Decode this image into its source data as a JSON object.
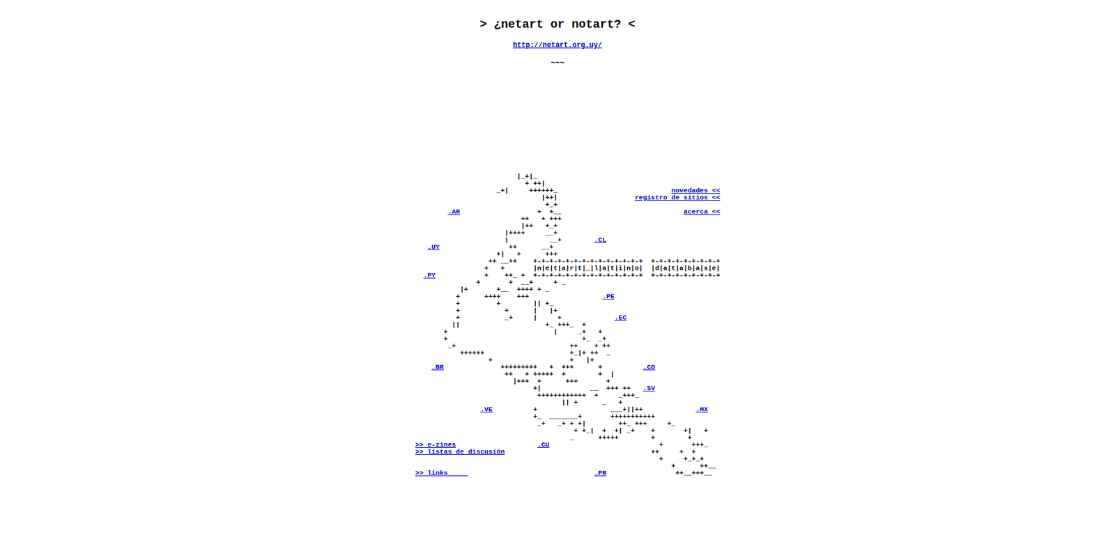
{
  "page": {
    "title": "> ¿netart or notart? <",
    "url": "http://netart.org.uy/",
    "divider": "~~~"
  },
  "art": [
    [
      {
        "text": "                         |_+|_",
        "link": false
      }
    ],
    [
      {
        "text": "                           + ++|",
        "link": false
      }
    ],
    [
      {
        "text": "                    _+|     ++++++_                            ",
        "link": false
      },
      {
        "text": "novedades <<",
        "link": true
      }
    ],
    [
      {
        "text": "                               |++|                   ",
        "link": false
      },
      {
        "text": "registro de sitios <<",
        "link": true
      }
    ],
    [
      {
        "text": "                                +_+",
        "link": false
      }
    ],
    [
      {
        "text": "        ",
        "link": false
      },
      {
        "text": ".AR",
        "link": true
      },
      {
        "text": "                   +  +__                              ",
        "link": false
      },
      {
        "text": "acerca <<",
        "link": true
      }
    ],
    [
      {
        "text": "                          ++   + +++",
        "link": false
      }
    ],
    [
      {
        "text": "                          |++   +_+",
        "link": false
      }
    ],
    [
      {
        "text": "                      |++++     __+",
        "link": false
      }
    ],
    [
      {
        "text": "                      |          __+        ",
        "link": false
      },
      {
        "text": ".CL",
        "link": true
      }
    ],
    [
      {
        "text": "   ",
        "link": false
      },
      {
        "text": ".UY",
        "link": true
      },
      {
        "text": "                 ++      __+",
        "link": false
      }
    ],
    [
      {
        "text": "                    +|   +      +++",
        "link": false
      }
    ],
    [
      {
        "text": "                  ++ __++    +-+-+-+-+-+-+-+-+-+-+-+-+-+  +-+-+-+-+-+-+-+-+",
        "link": false
      }
    ],
    [
      {
        "text": "                 +   +       |n|e|t|a|r|t|_|l|a|t|i|n|o|  |d|a|t|a|b|a|s|e|",
        "link": false
      }
    ],
    [
      {
        "text": "  ",
        "link": false
      },
      {
        "text": ".PY",
        "link": true
      },
      {
        "text": "            +    ++_ +  +-+-+-+-+-+-+-+-+-+-+-+-+-+  +-+-+-+-+-+-+-+-+",
        "link": false
      }
    ],
    [
      {
        "text": "               +       +  __+     + _",
        "link": false
      }
    ],
    [
      {
        "text": "           |+       +__  ++++ + _",
        "link": false
      }
    ],
    [
      {
        "text": "          +      ++++    +++                  ",
        "link": false
      },
      {
        "text": ".PE",
        "link": true
      }
    ],
    [
      {
        "text": "          +         +        || +_",
        "link": false
      }
    ],
    [
      {
        "text": "          +           +      |   |+",
        "link": false
      }
    ],
    [
      {
        "text": "          +           _+     |     +             ",
        "link": false
      },
      {
        "text": ".EC",
        "link": true
      }
    ],
    [
      {
        "text": "         ||                     +_ +++_  +",
        "link": false
      }
    ],
    [
      {
        "text": "       +                          |     _+   +",
        "link": false
      }
    ],
    [
      {
        "text": "       +                                 +_  _+",
        "link": false
      }
    ],
    [
      {
        "text": "        _+                            ++    + ++",
        "link": false
      }
    ],
    [
      {
        "text": "           ++++++                     +_|+ ++  _",
        "link": false
      }
    ],
    [
      {
        "text": "                  +                   +   |+",
        "link": false
      }
    ],
    [
      {
        "text": "    ",
        "link": false
      },
      {
        "text": ".BR",
        "link": true
      },
      {
        "text": "              +++++++++   +  +++      +          ",
        "link": false
      },
      {
        "text": ".CO",
        "link": true
      }
    ],
    [
      {
        "text": "                      ++   + +++++  +        +  |",
        "link": false
      }
    ],
    [
      {
        "text": "                        |+++  +      +++       +",
        "link": false
      }
    ],
    [
      {
        "text": "                             +|            __  +++ ++   ",
        "link": false
      },
      {
        "text": ".SV",
        "link": true
      }
    ],
    [
      {
        "text": "                              ++++++++++++  +     _+++_",
        "link": false
      }
    ],
    [
      {
        "text": "                                    || +      _   +",
        "link": false
      }
    ],
    [
      {
        "text": "                ",
        "link": false
      },
      {
        "text": ".VE",
        "link": true
      },
      {
        "text": "          +                  ___+||++             ",
        "link": false
      },
      {
        "text": ".MX",
        "link": true
      }
    ],
    [
      {
        "text": "                             +_  _______+       +++++++++++",
        "link": false
      }
    ],
    [
      {
        "text": "                              _+   _+ + +|        ++_ +++     +_",
        "link": false
      }
    ],
    [
      {
        "text": "                                       + +_|  +  +| _+    +       +|   +",
        "link": false
      }
    ],
    [
      {
        "text": "                                      _      +++++        +        +",
        "link": false
      }
    ],
    [
      {
        "text": ">> e-zines",
        "link": true
      },
      {
        "text": "                    ",
        "link": false
      },
      {
        "text": ".CU",
        "link": true
      },
      {
        "text": "                           +       +++_",
        "link": false
      }
    ],
    [
      {
        "text": ">> listas de discusión",
        "link": true
      },
      {
        "text": "                                    ++     +  +",
        "link": false
      }
    ],
    [
      {
        "text": "                                                            +     +_+_+",
        "link": false
      }
    ],
    [
      {
        "text": "                                                               +      ++__",
        "link": false
      }
    ],
    [
      {
        "text": ">> links     ",
        "link": true
      },
      {
        "text": "                               ",
        "link": false
      },
      {
        "text": ".PR",
        "link": true
      },
      {
        "text": "                 ++__+++__",
        "link": false
      }
    ]
  ]
}
